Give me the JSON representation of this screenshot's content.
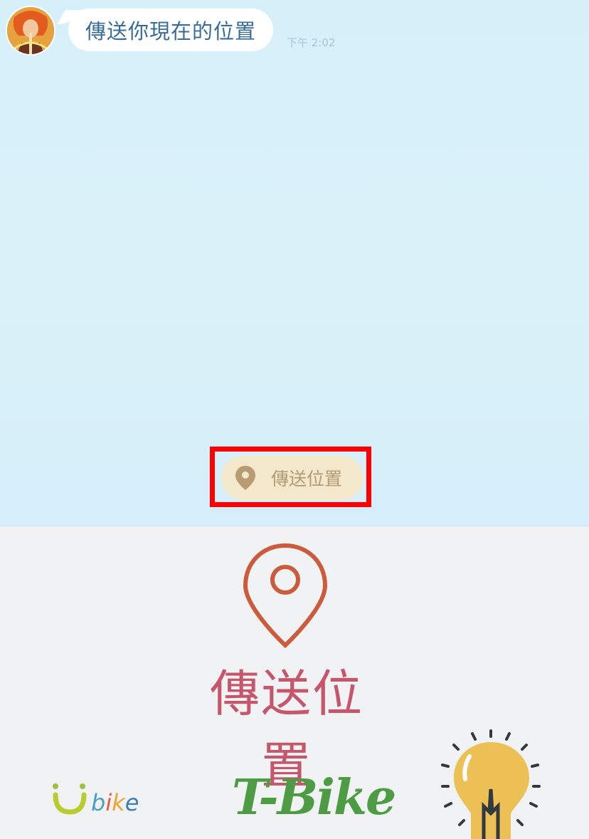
{
  "chat": {
    "message": "傳送你現在的位置",
    "time": "下午 2:02",
    "quick_reply_label": "傳送位置"
  },
  "rich_menu": {
    "send_location_label": "傳送位置",
    "ubike_u": "U",
    "ubike_b": "b",
    "ubike_i": "i",
    "ubike_k": "k",
    "ubike_e": "e",
    "tbike_label": "T-Bike"
  },
  "colors": {
    "chat_bg": "#d6f0fa",
    "bubble_text": "#3a6c9a",
    "quick_reply_bg": "#f3e8c9",
    "highlight": "#ff0000",
    "pin_red": "#cc5a3c",
    "label_red": "#c6566b",
    "tbike_green": "#4d9b42",
    "bulb_yellow": "#ecc055"
  },
  "icons": [
    "avatar",
    "location-pin-icon",
    "ubike-logo",
    "tbike-logo",
    "lightbulb-icon"
  ]
}
